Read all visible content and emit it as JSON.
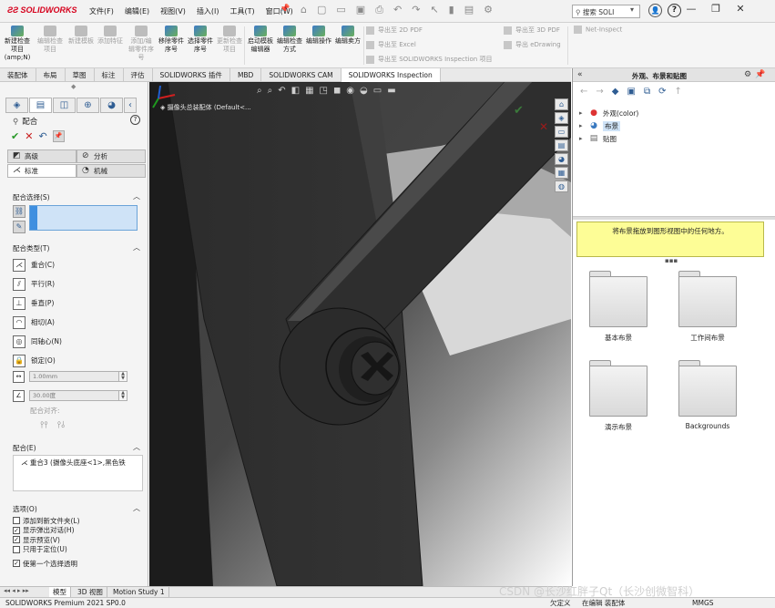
{
  "app": {
    "logo": "SOLIDWORKS",
    "menus": [
      "文件(F)",
      "编辑(E)",
      "视图(V)",
      "插入(I)",
      "工具(T)",
      "窗口(W)"
    ],
    "search_placeholder": "搜索 SOLI"
  },
  "ribbon": {
    "buttons": [
      {
        "label": "新建检查项目(amp;N)",
        "active": true
      },
      {
        "label": "编辑检查项目",
        "active": false
      },
      {
        "label": "新建模板",
        "active": false
      },
      {
        "label": "添加特征",
        "active": false
      },
      {
        "label": "添加/编辑零件序号",
        "active": false
      },
      {
        "label": "移除零件序号",
        "active": true
      },
      {
        "label": "选择零件序号",
        "active": true
      },
      {
        "label": "更新检查项目",
        "active": false
      },
      {
        "label": "启动模板编辑器",
        "active": true
      },
      {
        "label": "编辑检查方式",
        "active": true
      },
      {
        "label": "编辑操作",
        "active": true
      },
      {
        "label": "编辑卖方",
        "active": true
      }
    ],
    "exports": [
      "导出至 2D PDF",
      "导出至 Excel",
      "导出至 SOLIDWORKS Inspection 项目",
      "导出至 3D PDF",
      "导出 eDrawing",
      "Net-Inspect"
    ]
  },
  "tabs": [
    "装配体",
    "布局",
    "草图",
    "标注",
    "评估",
    "SOLIDWORKS 插件",
    "MBD",
    "SOLIDWORKS CAM",
    "SOLIDWORKS Inspection"
  ],
  "property_manager": {
    "title": "配合",
    "modes": {
      "advanced": "高级",
      "analysis": "分析",
      "standard": "标准",
      "mechanical": "机械"
    },
    "selection_header": "配合选择(S)",
    "types_header": "配合类型(T)",
    "mate_types": [
      "重合(C)",
      "平行(R)",
      "垂直(P)",
      "相切(A)",
      "同轴心(N)",
      "锁定(O)"
    ],
    "distance_value": "1.00mm",
    "angle_value": "30.00度",
    "alignment_label": "配合对齐:",
    "mates_header": "配合(E)",
    "mates": [
      "重合3 (摄像头底座<1>,黑色铁"
    ],
    "options_header": "选项(O)",
    "options": [
      {
        "label": "添加到新文件夹(L)",
        "checked": false
      },
      {
        "label": "显示弹出对话(H)",
        "checked": true
      },
      {
        "label": "显示预览(V)",
        "checked": true
      },
      {
        "label": "只用于定位(U)",
        "checked": false
      },
      {
        "label": "使第一个选择透明",
        "checked": true
      }
    ]
  },
  "viewport": {
    "doc_title": "摄像头总装配体 (Default<..."
  },
  "task_pane": {
    "title": "外观、布景和贴图",
    "tree": [
      {
        "label": "外观(color)",
        "icon": "appearance-sphere-icon",
        "selected": false
      },
      {
        "label": "布景",
        "icon": "scene-icon",
        "selected": true
      },
      {
        "label": "贴图",
        "icon": "decal-icon",
        "selected": false
      }
    ],
    "hint": "将布景拖放到图形视图中的任何地方。",
    "folders": [
      "基本布景",
      "工作间布景",
      "演示布景",
      "Backgrounds"
    ]
  },
  "bottom_tabs": [
    "模型",
    "3D 视图",
    "Motion Study 1"
  ],
  "status": {
    "product": "SOLIDWORKS Premium 2021 SP0.0",
    "constraint": "欠定义",
    "editing": "在编辑 装配体",
    "units": "MMGS"
  },
  "watermark": "CSDN @长沙红胖子Qt（长沙创微智科）"
}
